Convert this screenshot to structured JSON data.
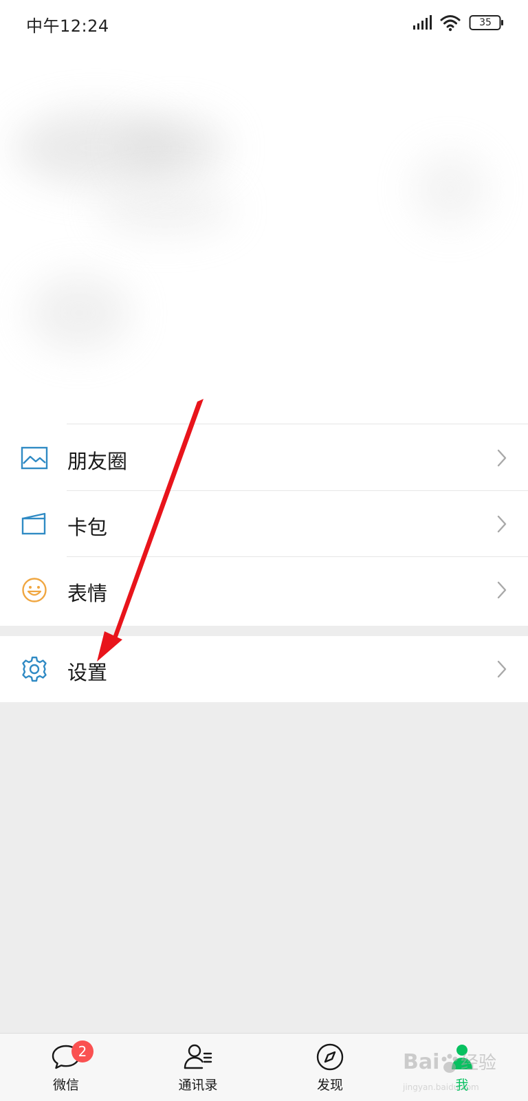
{
  "status_bar": {
    "time": "中午12:24",
    "battery": "35"
  },
  "menu": {
    "items": [
      {
        "label": "朋友圈",
        "icon": "moments-image-icon",
        "color": "#2f8ac4"
      },
      {
        "label": "卡包",
        "icon": "card-wallet-icon",
        "color": "#2f8ac4"
      },
      {
        "label": "表情",
        "icon": "smiley-icon",
        "color": "#f0a640"
      }
    ],
    "settings": {
      "label": "设置",
      "icon": "gear-icon",
      "color": "#2f8ac4"
    }
  },
  "tab_bar": {
    "tabs": [
      {
        "label": "微信",
        "icon": "chat-icon",
        "badge": "2",
        "active": false
      },
      {
        "label": "通讯录",
        "icon": "contacts-icon",
        "active": false
      },
      {
        "label": "发现",
        "icon": "compass-icon",
        "active": false
      },
      {
        "label": "我",
        "icon": "me-person-icon",
        "active": true
      }
    ]
  },
  "watermark": {
    "text": "Bai 经验",
    "sub": "jingyan.baidu.com"
  },
  "colors": {
    "accent": "#07c160",
    "badge": "#fa5151",
    "annotation": "#e8141b",
    "page_background": "#ededed"
  }
}
